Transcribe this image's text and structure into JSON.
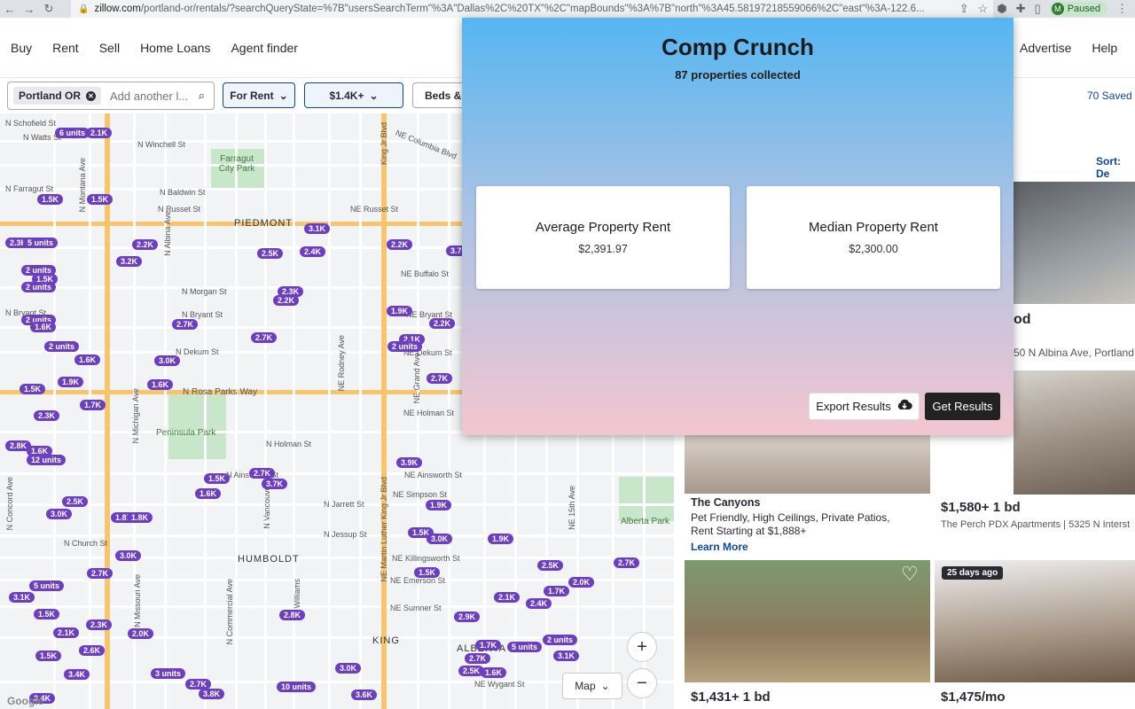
{
  "browser": {
    "url_host": "zillow.com",
    "url_rest": "/portland-or/rentals/?searchQueryState=%7B\"usersSearchTerm\"%3A\"Dallas%2C%20TX\"%2C\"mapBounds\"%3A%7B\"north\"%3A45.58197218559066%2C\"east\"%3A-122.6...",
    "profile_initial": "M",
    "profile_status": "Paused"
  },
  "nav": {
    "left": [
      "Buy",
      "Rent",
      "Sell",
      "Home Loans",
      "Agent finder"
    ],
    "right_partial": "s",
    "advertise": "Advertise",
    "help": "Help"
  },
  "filters": {
    "location_chip": "Portland OR",
    "search_placeholder": "Add another l...",
    "for_rent": "For Rent",
    "price": "$1.4K+",
    "beds": "Beds & B",
    "saved": "70 Saved"
  },
  "map": {
    "streets": {
      "n_schofield": "N Schofield St",
      "n_watts": "N Watts St",
      "n_winchell": "N Winchell St",
      "n_farragut": "N Farragut St",
      "n_baldwin": "N Baldwin St",
      "n_russet": "N Russet St",
      "ne_russet": "NE Russet St",
      "ne_columbia": "NE Columbia Blvd",
      "piedmont": "PIEDMONT",
      "ne_buffalo": "NE Buffalo St",
      "n_morgan": "N Morgan St",
      "n_bryant": "N Bryant St",
      "ne_bryant": "NE Bryant St",
      "n_dekum": "N Dekum St",
      "ne_dekum": "NE Dekum St",
      "n_rosa_parks": "N Rosa Parks Way",
      "ne_holman": "NE Holman St",
      "n_holman": "N Holman St",
      "n_ainsworth": "N Ainsworth St",
      "ne_ainsworth": "NE Ainsworth St",
      "ne_simpson": "NE Simpson St",
      "n_jarrett": "N Jarrett St",
      "n_jessup": "N Jessup St",
      "n_church": "N Church St",
      "humboldt": "HUMBOLDT",
      "ne_killingsworth": "NE Killingsworth St",
      "ne_emerson": "NE Emerson St",
      "ne_sumner": "NE Sumner St",
      "king": "KING",
      "ne_wygant": "NE Wygant St",
      "ne_alberta": "ALBERTA",
      "n_albina": "N Albina Ave",
      "n_vancouver": "N Vancouver Ave",
      "ne_mlk": "NE Martin Luther King Jr Blvd",
      "king_jr_blvd": "King Jr Blvd",
      "n_michigan": "N Michigan Ave",
      "n_commercial": "N Commercial Ave",
      "n_williams": "N Williams",
      "ne_15th": "NE 15th Ave",
      "ne_grand": "NE Grand Ave",
      "ne_rodney": "NE Rodney Ave",
      "n_montana": "N Montana Ave",
      "n_concord": "N Concord Ave",
      "n_missouri": "N Missouri Ave"
    },
    "parks": {
      "farragut": "Farragut City Park",
      "peninsula": "Peninsula Park",
      "alberta": "Alberta Park"
    },
    "pins": [
      "6 units",
      "2.1K",
      "1.5K",
      "1.5K",
      "3.1K",
      "2.2K",
      "3.2K",
      "2.5K",
      "2.4K",
      "2.2K",
      "3.7K",
      "2.3K",
      "5 units",
      "2 units",
      "1.5K",
      "2 units",
      "2.3K",
      "2.2K",
      "1.9K",
      "2.2K",
      "2 units",
      "1.6K",
      "2.7K",
      "2.7K",
      "2.1K",
      "2 units",
      "3.0K",
      "2 units",
      "1.6K",
      "1.5K",
      "1.9K",
      "1.6K",
      "2.7K",
      "1.7K",
      "2.3K",
      "2.8K",
      "1.6K",
      "12 units",
      "3.9K",
      "1.5K",
      "2.7K",
      "1.6K",
      "3.7K",
      "2.5K",
      "3.0K",
      "1.9K",
      "1.8K",
      "1.8K",
      "1.5K",
      "3.0K",
      "1.9K",
      "3.0K",
      "1.5K",
      "2.5K",
      "2.7K",
      "5 units",
      "2.7K",
      "3.1K",
      "1.5K",
      "2.0K",
      "1.7K",
      "2.1K",
      "2.4K",
      "2.8K",
      "2.9K",
      "2.1K",
      "2.3K",
      "2.0K",
      "1.5K",
      "2.6K",
      "1.7K",
      "5 units",
      "2 units",
      "2.7K",
      "2.5K",
      "1.6K",
      "3.1K",
      "3 units",
      "3.4K",
      "2.7K",
      "3.8K",
      "10 units",
      "3.0K",
      "3.6K",
      "3.4K"
    ],
    "map_type": "Map",
    "zoom_in": "+",
    "zoom_out": "−",
    "google": "Google"
  },
  "listings": {
    "sort": "Sort: De",
    "cards": [
      {
        "title_partial": "od",
        "address": "50 N Albina Ave, Portland, O"
      },
      {
        "name": "The Canyons",
        "desc": "Pet Friendly, High Ceilings, Private Patios, Rent Starting at $1,888+",
        "cta": "Learn More"
      },
      {
        "price": "$1,580+ 1 bd",
        "address": "The Perch PDX Apartments | 5325 N Interst"
      },
      {
        "price": "$1,431+ 1 bd"
      },
      {
        "badge": "25 days ago",
        "price": "$1,475/mo"
      }
    ]
  },
  "comp_crunch": {
    "title": "Comp Crunch",
    "count": "87 properties collected",
    "average_label": "Average Property Rent",
    "average_value": "$2,391.97",
    "median_label": "Median Property Rent",
    "median_value": "$2,300.00",
    "export_label": "Export Results",
    "get_label": "Get Results"
  }
}
